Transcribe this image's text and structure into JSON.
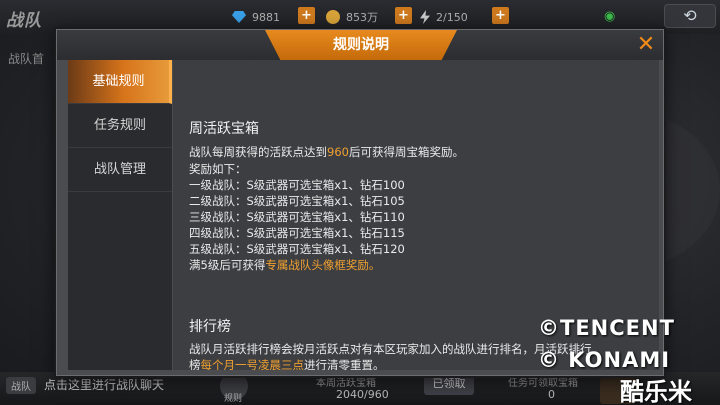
{
  "topbar": {
    "game_logo": "战队",
    "diamonds": "9881",
    "gold": "853万",
    "energy": "2/150"
  },
  "background": {
    "tab_label": "战队首",
    "chat_tag": "战队",
    "chat_hint": "点击这里进行战队聊天",
    "rules_label": "规则",
    "weekly_box_label": "本周活跃宝箱",
    "weekly_box_value": "2040/960",
    "claimed_label": "已领取",
    "task_box_label": "任务可领取宝箱",
    "task_box_value": "0"
  },
  "modal": {
    "title": "规则说明",
    "close_icon": "close-icon",
    "tabs": [
      "基础规则",
      "任务规则",
      "战队管理"
    ],
    "active_tab": 0,
    "weekly": {
      "heading": "周活跃宝箱",
      "intro_before": "战队每周获得的活跃点达到",
      "intro_value": "960",
      "intro_after": "后可获得周宝箱奖励。",
      "reward_header": "奖励如下：",
      "rewards": [
        "一级战队：S级武器可选宝箱x1、钻石100",
        "二级战队：S级武器可选宝箱x1、钻石105",
        "三级战队：S级武器可选宝箱x1、钻石110",
        "四级战队：S级武器可选宝箱x1、钻石115",
        "五级战队：S级武器可选宝箱x1、钻石120"
      ],
      "note_before": "满5级后可获得",
      "note_highlight": "专属战队头像框奖励。"
    },
    "ranking": {
      "heading": "排行榜",
      "line1": "战队月活跃排行榜会按月活跃点对有本区玩家加入的战队进行排名，月活跃排行",
      "line2_before": "榜",
      "line2_highlight": "每个月一号凌晨三点",
      "line2_after": "进行清零重置。"
    }
  },
  "watermarks": {
    "tencent": "©TENCENT",
    "konami": "© KONAMI",
    "site": "酷乐米"
  },
  "colors": {
    "accent": "#e78a1e",
    "highlight": "#f0a030"
  }
}
